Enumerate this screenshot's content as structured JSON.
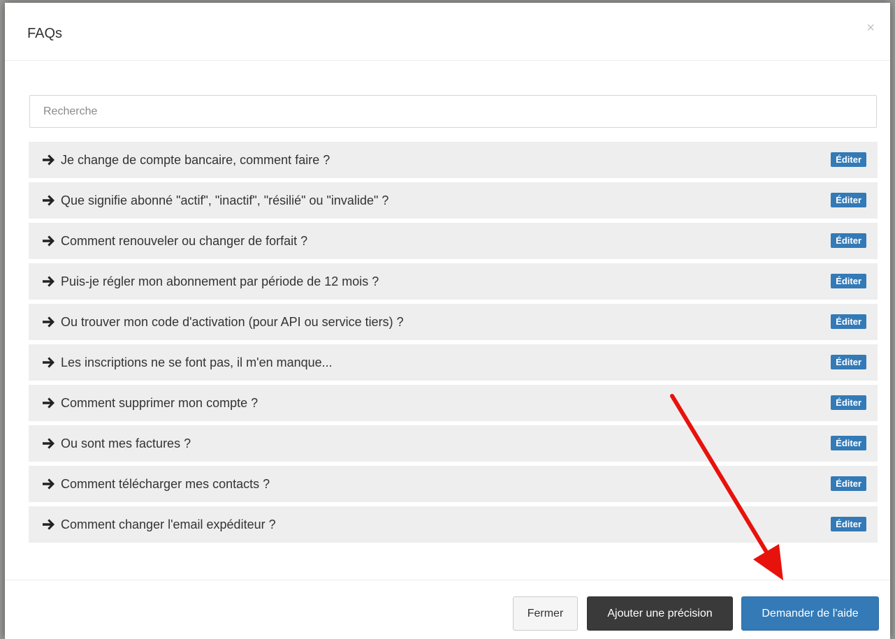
{
  "modal": {
    "title": "FAQs",
    "close_label": "×"
  },
  "search": {
    "placeholder": "Recherche",
    "value": ""
  },
  "faq": {
    "edit_label": "Éditer",
    "items": [
      {
        "question": "Je change de compte bancaire, comment faire ?"
      },
      {
        "question": "Que signifie abonné \"actif\", \"inactif\", \"résilié\" ou \"invalide\" ?"
      },
      {
        "question": "Comment renouveler ou changer de forfait ?"
      },
      {
        "question": "Puis-je régler mon abonnement par période de 12 mois ?"
      },
      {
        "question": "Ou trouver mon code d'activation (pour API ou service tiers) ?"
      },
      {
        "question": "Les inscriptions ne se font pas, il m'en manque..."
      },
      {
        "question": "Comment supprimer mon compte ?"
      },
      {
        "question": "Ou sont mes factures ?"
      },
      {
        "question": "Comment télécharger mes contacts ?"
      },
      {
        "question": "Comment changer l'email expéditeur ?"
      }
    ]
  },
  "footer": {
    "close_label": "Fermer",
    "add_precision_label": "Ajouter une précision",
    "ask_help_label": "Demander de l'aide"
  },
  "icons": {
    "faq_item_icon": "arrow-right-icon",
    "close_icon": "close-icon",
    "annotation": "red-arrow-annotation"
  },
  "colors": {
    "primary": "#337ab7",
    "dark_button": "#3a3a3a",
    "row_background": "#eeeeee",
    "annotation_red": "#e8120c"
  }
}
